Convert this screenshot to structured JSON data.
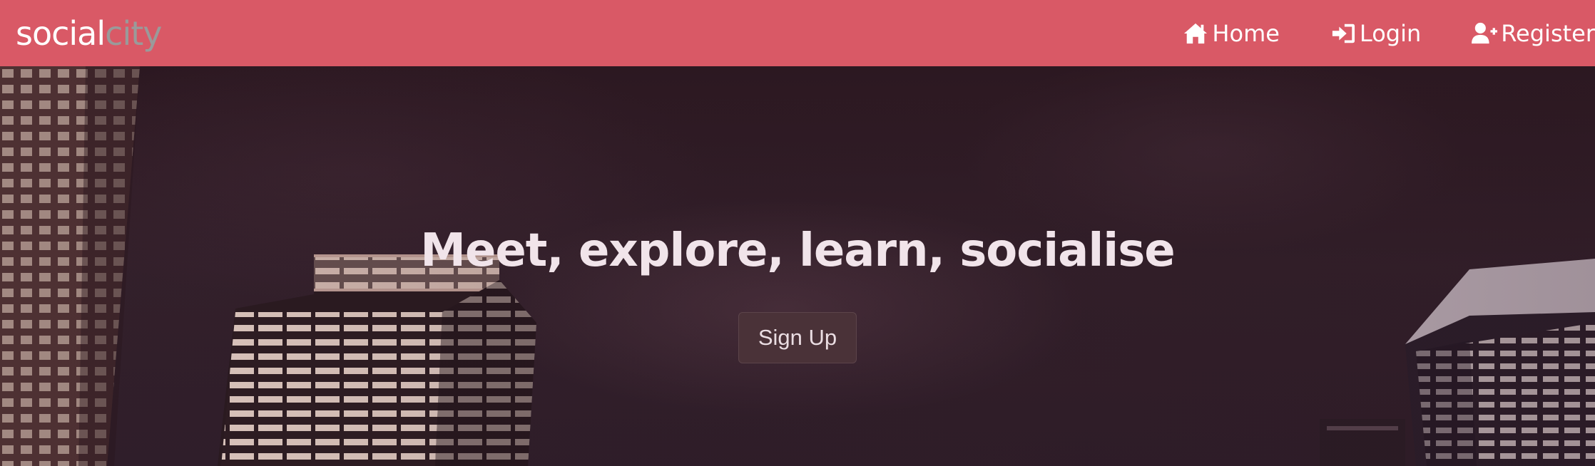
{
  "brand": {
    "part1": "social",
    "part2": "city"
  },
  "nav": [
    {
      "label": "Home",
      "icon": "home-icon"
    },
    {
      "label": "Login",
      "icon": "sign-in-icon"
    },
    {
      "label": "Register",
      "icon": "user-plus-icon"
    }
  ],
  "hero": {
    "title": "Meet, explore, learn, socialise",
    "signup_label": "Sign Up"
  },
  "colors": {
    "navbar_bg": "#d95966",
    "brand_secondary": "#9a9a9a",
    "hero_overlay": "#2e1a24",
    "button_bg": "#4a3238"
  }
}
